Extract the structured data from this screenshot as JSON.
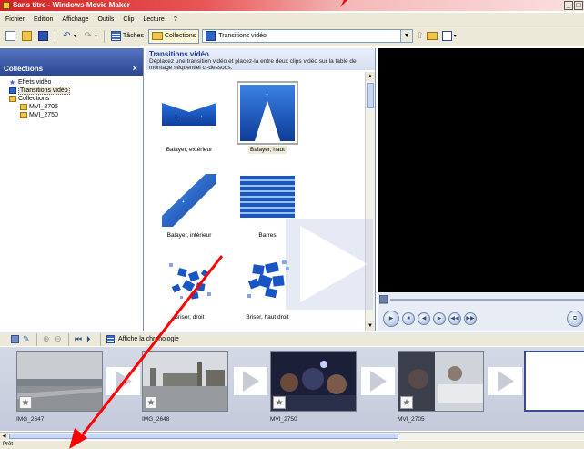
{
  "window": {
    "title": "Sans titre - Windows Movie Maker"
  },
  "menu": [
    "Fichier",
    "Edition",
    "Affichage",
    "Outils",
    "Clip",
    "Lecture",
    "?"
  ],
  "toolbar": {
    "tasks_label": "Tâches",
    "collections_label": "Collections",
    "location_value": "Transitions vidéo"
  },
  "collections_pane": {
    "title": "Collections",
    "close": "×",
    "tree": [
      {
        "label": "Effets vidéo",
        "icon": "star-icon",
        "indent": 0,
        "selected": false
      },
      {
        "label": "Transitions vidéo",
        "icon": "transition-icon",
        "indent": 0,
        "selected": true
      },
      {
        "label": "Collections",
        "icon": "folder-icon",
        "indent": 0,
        "selected": false
      },
      {
        "label": "MVI_2705",
        "icon": "folder-icon",
        "indent": 1,
        "selected": false
      },
      {
        "label": "MVI_2750",
        "icon": "folder-icon",
        "indent": 1,
        "selected": false
      }
    ]
  },
  "transitions_pane": {
    "title": "Transitions vidéo",
    "description": "Déplacez une transition vidéo et placez-la entre deux clips vidéo sur la table de montage séquentiel ci-dessous.",
    "items": [
      {
        "label": "Balayer, extérieur",
        "selected": false
      },
      {
        "label": "Balayer, haut",
        "selected": true
      },
      {
        "label": "Balayer, intérieur",
        "selected": false
      },
      {
        "label": "Barres",
        "selected": false
      },
      {
        "label": "Briser, droit",
        "selected": false
      },
      {
        "label": "Briser, haut droit",
        "selected": false
      }
    ]
  },
  "storyboard_toolbar": {
    "timeline_label": "Affiche la chronologie"
  },
  "storyboard": {
    "clips": [
      {
        "name": "IMG_2647"
      },
      {
        "name": "IMG_2648"
      },
      {
        "name": "MVI_2750"
      },
      {
        "name": "MVI_2705"
      }
    ]
  },
  "status": {
    "text": "Prêt"
  },
  "colors": {
    "accent": "#2b4791",
    "arrow": "#ff0000",
    "transition_blue": "#2b63c6"
  }
}
